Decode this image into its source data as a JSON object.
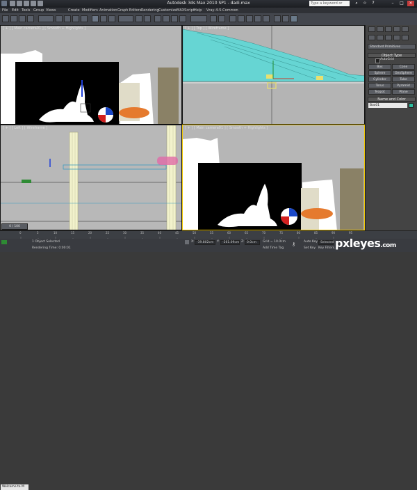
{
  "app": {
    "title": "Autodesk 3ds Max 2010 SP1  -  dadi.max",
    "search_placeholder": "Type a keyword or phrase"
  },
  "menu": [
    "File",
    "Edit",
    "Tools",
    "Group",
    "Views",
    "Create",
    "Modifiers",
    "Animation",
    "Graph Editors",
    "Rendering",
    "Customize",
    "MAXScript",
    "Help",
    "Vray-4-5-Common"
  ],
  "viewports": {
    "top_left": "[ + ] [ Main camera01 ] [ Smooth + Highlights ]",
    "top_right": "[ + ] [ Top ] [ Wireframe ]",
    "bottom_left": "[ + ] [ Left ] [ Wireframe ]",
    "bottom_right": "[ + ] [ Main camera01 ] [ Smooth + Highlights ]"
  },
  "command_panel": {
    "dropdown": "Standard Primitives",
    "object_type_title": "Object Type",
    "autogrid": "AutoGrid",
    "buttons": [
      "Box",
      "Cone",
      "Sphere",
      "GeoSphere",
      "Cylinder",
      "Tube",
      "Torus",
      "Pyramid",
      "Teapot",
      "Plane"
    ],
    "name_color_title": "Name and Color",
    "name_value": "Box01",
    "swatch_color": "#2dbfa0"
  },
  "timeline": {
    "frame_counter": "0 / 100",
    "ticks": [
      "0",
      "5",
      "10",
      "15",
      "20",
      "25",
      "30",
      "35",
      "40",
      "45",
      "50",
      "55",
      "60",
      "65",
      "70",
      "75",
      "80",
      "85",
      "90",
      "95",
      "100"
    ]
  },
  "status": {
    "selection": "1 Object Selected",
    "render_time": "Rendering Time: 0:00:01",
    "x_label": "X:",
    "x_value": "-39.802cm",
    "y_label": "Y:",
    "y_value": "-261.09cm",
    "z_label": "Z:",
    "z_value": "0.0cm",
    "grid": "Grid = 10.0cm",
    "add_time_tag": "Add Time Tag",
    "auto_key": "Auto Key",
    "selected": "Selected",
    "set_key": "Set Key",
    "key_filters": "Key Filters...",
    "welcome": "Welcome to M"
  },
  "watermark": {
    "main": "pxleyes",
    "suffix": ".com"
  },
  "colors": {
    "viewport_bg": "#b4b4b4",
    "active_border": "#f0c800",
    "teal_wire": "#66d5d3",
    "timeline_green": "#2e8b34"
  }
}
